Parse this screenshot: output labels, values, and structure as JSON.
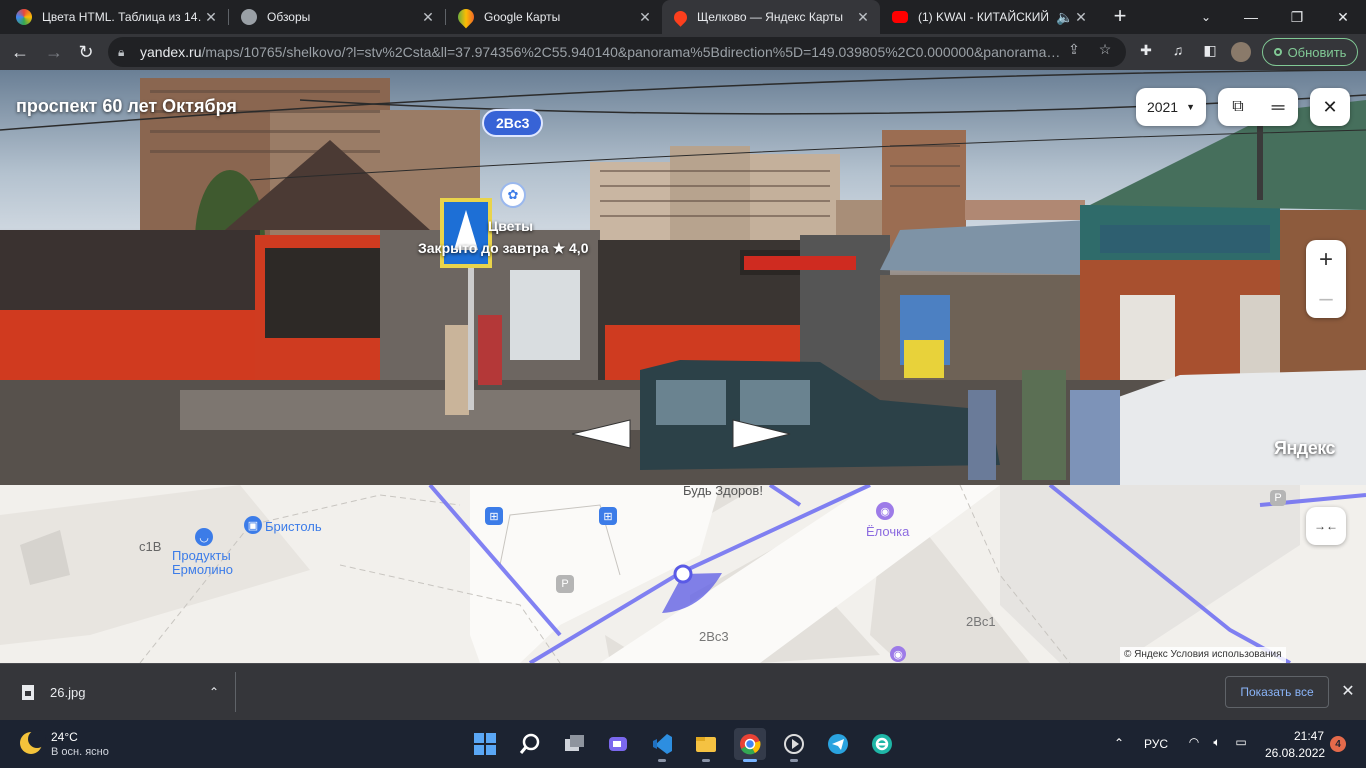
{
  "browser": {
    "tabs": [
      {
        "title": "Цвета HTML. Таблица из 14…",
        "favicon_color": "#e8453c"
      },
      {
        "title": "Обзоры",
        "favicon_color": "#9aa0a6"
      },
      {
        "title": "Google Карты",
        "favicon_color": "#34a853"
      },
      {
        "title": "Щелково — Яндекс Карты",
        "favicon_color": "#fc3f1d"
      },
      {
        "title": "(1) KWAI - КИТАЙСКИЙ",
        "favicon_color": "#ff0000"
      }
    ],
    "active_tab": 3,
    "tab_close_glyph": "✕",
    "newtab_glyph": "+",
    "url_host": "yandex.ru",
    "url_path": "/maps/10765/shelkovo/?l=stv%2Csta&ll=37.974356%2C55.940140&panorama%5Bdirection%5D=149.039805%2C0.000000&panorama…",
    "update_label": "Обновить"
  },
  "panorama": {
    "street_title": "проспект 60 лет Октября",
    "house_badge": "2Вс3",
    "year": "2021",
    "poi_name": "Цветы",
    "poi_status": "Закрыто до завтра ★ 4,0",
    "zoom_in": "+",
    "zoom_out": "–",
    "logo": "Яндекс"
  },
  "map": {
    "labels": {
      "bud_zdorov": "Будь Здоров!",
      "bristol": "Бристоль",
      "s1v": "с1В",
      "produkty": "Продукты",
      "ermolino": "Ермолино",
      "elochka": "Ёлочка",
      "b2vs3": "2Вс3",
      "b2vs1": "2Вс1"
    },
    "collapse_glyph": "→←",
    "copyright": "© Яндекс   Условия использования"
  },
  "downloads": {
    "file_name": "26.jpg",
    "show_all": "Показать все",
    "close_glyph": "✕"
  },
  "taskbar": {
    "weather_temp": "24°C",
    "weather_desc": "В осн. ясно",
    "lang": "РУС",
    "time": "21:47",
    "date": "26.08.2022",
    "notifications": "4"
  }
}
